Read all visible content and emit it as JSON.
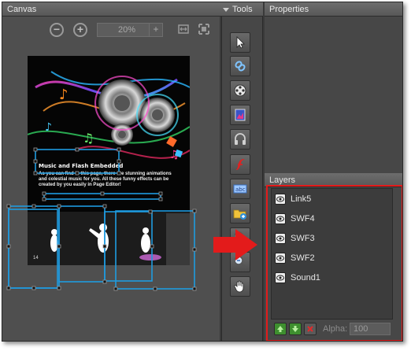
{
  "panels": {
    "canvas_title": "Canvas",
    "tools_title": "Tools",
    "properties_title": "Properties",
    "layers_title": "Layers"
  },
  "canvas": {
    "zoom_value": "20%",
    "zoom_plus": "+",
    "page": {
      "heading": "Music and Flash Embedded",
      "body": "As you can find in this page, there are stunning animations and colestial music for you. All these funny effects can be created by you easily in Page Editor!",
      "page_number": "14"
    }
  },
  "tools": [
    {
      "name": "select-tool",
      "icon": "pointer-arrow-icon"
    },
    {
      "name": "link-tool",
      "icon": "chain-link-icon"
    },
    {
      "name": "video-tool",
      "icon": "film-reel-icon"
    },
    {
      "name": "image-tool",
      "icon": "picture-icon"
    },
    {
      "name": "sound-tool",
      "icon": "headphones-icon"
    },
    {
      "name": "flash-tool",
      "icon": "flash-icon"
    },
    {
      "name": "text-tool",
      "icon": "text-box-icon"
    },
    {
      "name": "add-image-tool",
      "icon": "folder-add-icon"
    },
    {
      "name": "zoom-in-tool",
      "icon": "zoom-in-icon"
    },
    {
      "name": "zoom-out-tool",
      "icon": "zoom-out-icon"
    },
    {
      "name": "hand-tool",
      "icon": "hand-icon"
    }
  ],
  "layers": {
    "items": [
      {
        "label": "Link5"
      },
      {
        "label": "SWF4"
      },
      {
        "label": "SWF3"
      },
      {
        "label": "SWF2"
      },
      {
        "label": "Sound1"
      }
    ],
    "alpha_label": "Alpha:",
    "alpha_value": "100"
  },
  "colors": {
    "highlight": "#e31b1b",
    "selection": "#1e9be0",
    "panel_bg": "#474747"
  }
}
